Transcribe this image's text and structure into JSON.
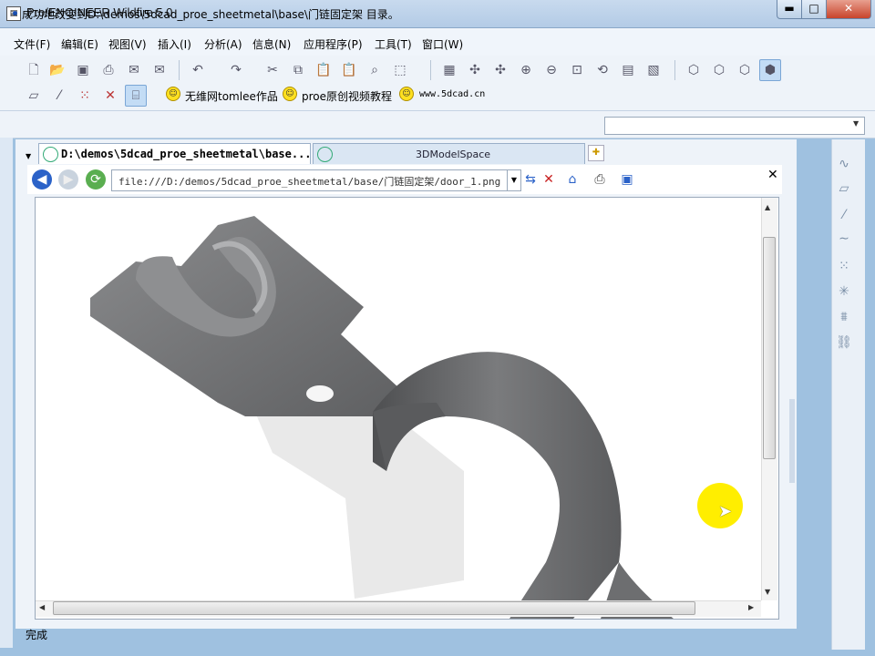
{
  "window": {
    "title": "Pro/ENGINEER Wildfire 5.0",
    "controls": {
      "minimize": "▬",
      "maximize": "□",
      "close": "✕"
    }
  },
  "menu": [
    "文件(F)",
    "编辑(E)",
    "视图(V)",
    "插入(I)",
    "分析(A)",
    "信息(N)",
    "应用程序(P)",
    "工具(T)",
    "窗口(W)"
  ],
  "toolbar": {
    "row1_icons": [
      "new-file-icon",
      "open-folder-icon",
      "save-icon",
      "print-icon",
      "email-icon",
      "email-attach-icon",
      "undo-icon",
      "redo-icon",
      "cut-icon",
      "copy-icon",
      "paste-icon",
      "paste-special-icon",
      "find-icon",
      "select-box-icon",
      "repaint-icon",
      "spin-center-icon",
      "orient-icon",
      "zoom-in-icon",
      "zoom-out-icon",
      "refit-icon",
      "reorient-icon",
      "view-manager-icon",
      "saved-views-icon",
      "wireframe-icon",
      "hidden-line-icon",
      "no-hidden-icon",
      "shading-icon"
    ],
    "row2_icons": [
      "datum-planes-icon",
      "datum-axes-icon",
      "datum-points-icon",
      "datum-csys-icon",
      "annotation-display-icon"
    ],
    "links": [
      "无维网tomlee作品",
      "proe原创视频教程",
      "www.5dcad.cn"
    ]
  },
  "message": {
    "text": "成功地改变到D:\\demos\\5dcad_proe_sheetmetal\\base\\门链固定架 目录。",
    "command_value": ""
  },
  "browser": {
    "tabs": [
      {
        "label": "D:\\demos\\5dcad_proe_sheetmetal\\base...",
        "active": true
      },
      {
        "label": "3DModelSpace",
        "active": false
      }
    ],
    "url": "file:///D:/demos/5dcad_proe_sheetmetal/base/门链固定架/door_1.png"
  },
  "viewport": {
    "content": "sheet-metal-door-bracket-model",
    "part_color": "#6d6e70",
    "highlight_color": "#ffee00"
  },
  "right_toolbar_icons": [
    "sketch-icon",
    "plane-icon",
    "axis-icon",
    "curve-icon",
    "point-icon",
    "csys-icon",
    "analysis-icon",
    "chain-icon"
  ],
  "status": "完成"
}
